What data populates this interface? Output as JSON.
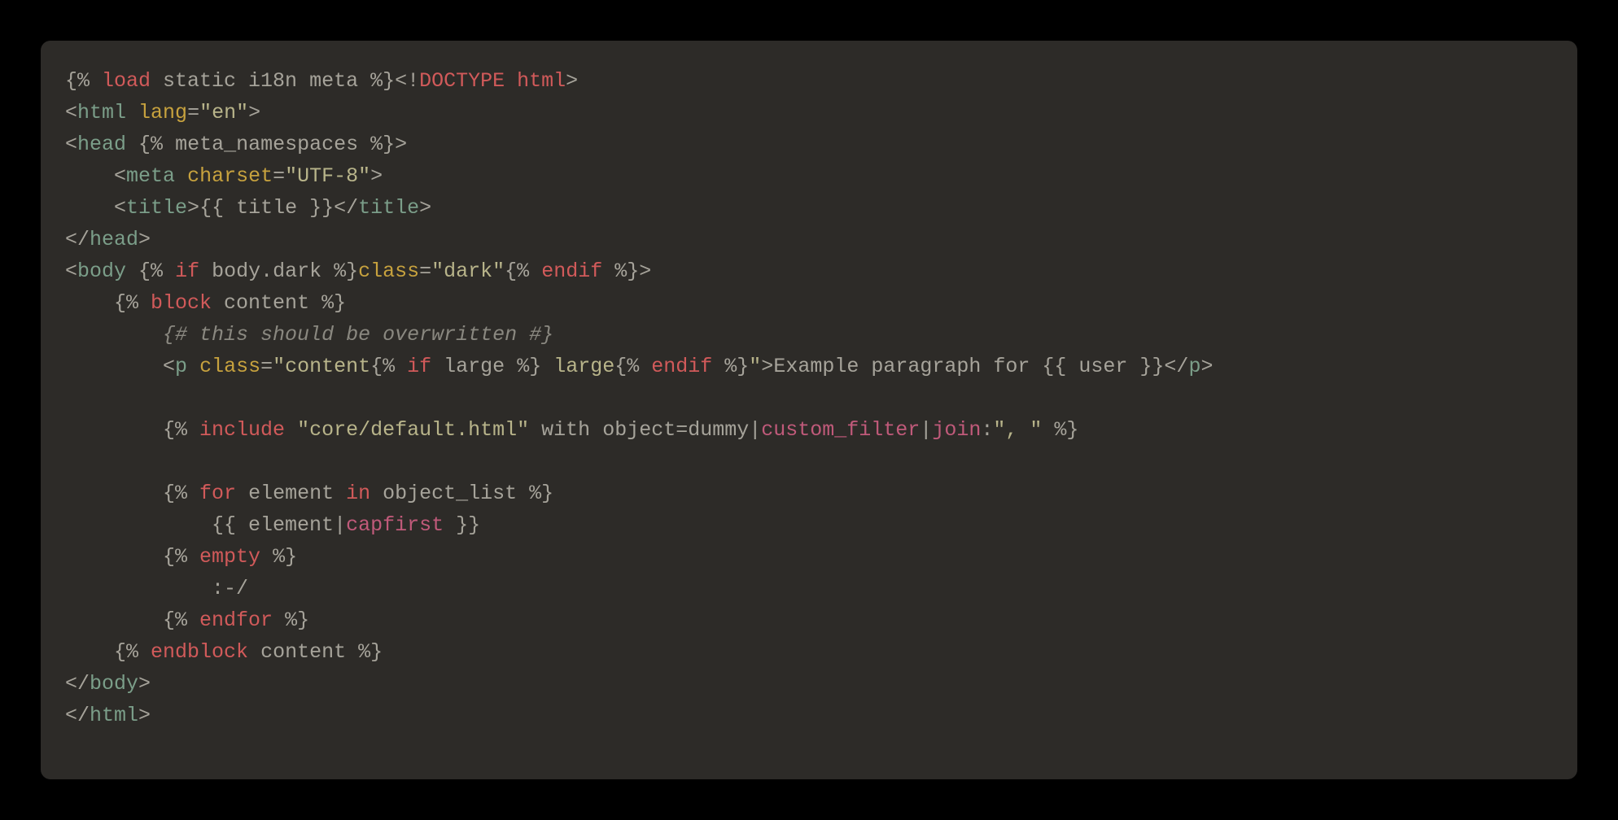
{
  "code": {
    "lines": [
      [
        {
          "t": "{% ",
          "c": "tok-delim"
        },
        {
          "t": "load",
          "c": "tok-keyword"
        },
        {
          "t": " static i18n meta ",
          "c": "tok-var"
        },
        {
          "t": "%}",
          "c": "tok-delim"
        },
        {
          "t": "<!",
          "c": "tok-delim"
        },
        {
          "t": "DOCTYPE html",
          "c": "tok-keyword"
        },
        {
          "t": ">",
          "c": "tok-delim"
        }
      ],
      [
        {
          "t": "<",
          "c": "tok-delim"
        },
        {
          "t": "html",
          "c": "tok-tag"
        },
        {
          "t": " ",
          "c": "tok-delim"
        },
        {
          "t": "lang",
          "c": "tok-attr"
        },
        {
          "t": "=",
          "c": "tok-delim"
        },
        {
          "t": "\"en\"",
          "c": "tok-string"
        },
        {
          "t": ">",
          "c": "tok-delim"
        }
      ],
      [
        {
          "t": "<",
          "c": "tok-delim"
        },
        {
          "t": "head",
          "c": "tok-tag"
        },
        {
          "t": " ",
          "c": "tok-delim"
        },
        {
          "t": "{% ",
          "c": "tok-delim"
        },
        {
          "t": "meta_namespaces",
          "c": "tok-var"
        },
        {
          "t": " %}",
          "c": "tok-delim"
        },
        {
          "t": ">",
          "c": "tok-delim"
        }
      ],
      [
        {
          "t": "    ",
          "c": "tok-delim"
        },
        {
          "t": "<",
          "c": "tok-delim"
        },
        {
          "t": "meta",
          "c": "tok-tag"
        },
        {
          "t": " ",
          "c": "tok-delim"
        },
        {
          "t": "charset",
          "c": "tok-attr"
        },
        {
          "t": "=",
          "c": "tok-delim"
        },
        {
          "t": "\"UTF-8\"",
          "c": "tok-string"
        },
        {
          "t": ">",
          "c": "tok-delim"
        }
      ],
      [
        {
          "t": "    ",
          "c": "tok-delim"
        },
        {
          "t": "<",
          "c": "tok-delim"
        },
        {
          "t": "title",
          "c": "tok-tag"
        },
        {
          "t": ">",
          "c": "tok-delim"
        },
        {
          "t": "{{ ",
          "c": "tok-delim"
        },
        {
          "t": "title",
          "c": "tok-var"
        },
        {
          "t": " }}",
          "c": "tok-delim"
        },
        {
          "t": "</",
          "c": "tok-delim"
        },
        {
          "t": "title",
          "c": "tok-tag"
        },
        {
          "t": ">",
          "c": "tok-delim"
        }
      ],
      [
        {
          "t": "</",
          "c": "tok-delim"
        },
        {
          "t": "head",
          "c": "tok-tag"
        },
        {
          "t": ">",
          "c": "tok-delim"
        }
      ],
      [
        {
          "t": "<",
          "c": "tok-delim"
        },
        {
          "t": "body",
          "c": "tok-tag"
        },
        {
          "t": " ",
          "c": "tok-delim"
        },
        {
          "t": "{% ",
          "c": "tok-delim"
        },
        {
          "t": "if",
          "c": "tok-keyword"
        },
        {
          "t": " body.dark ",
          "c": "tok-var"
        },
        {
          "t": "%}",
          "c": "tok-delim"
        },
        {
          "t": "class",
          "c": "tok-attr"
        },
        {
          "t": "=",
          "c": "tok-delim"
        },
        {
          "t": "\"dark\"",
          "c": "tok-string"
        },
        {
          "t": "{% ",
          "c": "tok-delim"
        },
        {
          "t": "endif",
          "c": "tok-keyword"
        },
        {
          "t": " %}",
          "c": "tok-delim"
        },
        {
          "t": ">",
          "c": "tok-delim"
        }
      ],
      [
        {
          "t": "    ",
          "c": "tok-delim"
        },
        {
          "t": "{% ",
          "c": "tok-delim"
        },
        {
          "t": "block",
          "c": "tok-keyword"
        },
        {
          "t": " content ",
          "c": "tok-var"
        },
        {
          "t": "%}",
          "c": "tok-delim"
        }
      ],
      [
        {
          "t": "        ",
          "c": "tok-delim"
        },
        {
          "t": "{# this should be overwritten #}",
          "c": "tok-comment"
        }
      ],
      [
        {
          "t": "        ",
          "c": "tok-delim"
        },
        {
          "t": "<",
          "c": "tok-delim"
        },
        {
          "t": "p",
          "c": "tok-tag"
        },
        {
          "t": " ",
          "c": "tok-delim"
        },
        {
          "t": "class",
          "c": "tok-attr"
        },
        {
          "t": "=",
          "c": "tok-delim"
        },
        {
          "t": "\"content",
          "c": "tok-string"
        },
        {
          "t": "{% ",
          "c": "tok-delim"
        },
        {
          "t": "if",
          "c": "tok-keyword"
        },
        {
          "t": " large ",
          "c": "tok-var"
        },
        {
          "t": "%}",
          "c": "tok-delim"
        },
        {
          "t": " large",
          "c": "tok-string"
        },
        {
          "t": "{% ",
          "c": "tok-delim"
        },
        {
          "t": "endif",
          "c": "tok-keyword"
        },
        {
          "t": " %}",
          "c": "tok-delim"
        },
        {
          "t": "\"",
          "c": "tok-string"
        },
        {
          "t": ">",
          "c": "tok-delim"
        },
        {
          "t": "Example paragraph for ",
          "c": "tok-text"
        },
        {
          "t": "{{ ",
          "c": "tok-delim"
        },
        {
          "t": "user",
          "c": "tok-var"
        },
        {
          "t": " }}",
          "c": "tok-delim"
        },
        {
          "t": "</",
          "c": "tok-delim"
        },
        {
          "t": "p",
          "c": "tok-tag"
        },
        {
          "t": ">",
          "c": "tok-delim"
        }
      ],
      [
        {
          "t": "",
          "c": "tok-delim"
        }
      ],
      [
        {
          "t": "        ",
          "c": "tok-delim"
        },
        {
          "t": "{% ",
          "c": "tok-delim"
        },
        {
          "t": "include",
          "c": "tok-keyword"
        },
        {
          "t": " ",
          "c": "tok-delim"
        },
        {
          "t": "\"core/default.html\"",
          "c": "tok-string"
        },
        {
          "t": " ",
          "c": "tok-delim"
        },
        {
          "t": "with",
          "c": "tok-var"
        },
        {
          "t": " ",
          "c": "tok-delim"
        },
        {
          "t": "object",
          "c": "tok-var"
        },
        {
          "t": "=",
          "c": "tok-delim"
        },
        {
          "t": "dummy",
          "c": "tok-var"
        },
        {
          "t": "|",
          "c": "tok-delim"
        },
        {
          "t": "custom_filter",
          "c": "tok-filter"
        },
        {
          "t": "|",
          "c": "tok-delim"
        },
        {
          "t": "join",
          "c": "tok-filter"
        },
        {
          "t": ":",
          "c": "tok-delim"
        },
        {
          "t": "\", \"",
          "c": "tok-string"
        },
        {
          "t": " %}",
          "c": "tok-delim"
        }
      ],
      [
        {
          "t": "",
          "c": "tok-delim"
        }
      ],
      [
        {
          "t": "        ",
          "c": "tok-delim"
        },
        {
          "t": "{% ",
          "c": "tok-delim"
        },
        {
          "t": "for",
          "c": "tok-keyword"
        },
        {
          "t": " element ",
          "c": "tok-var"
        },
        {
          "t": "in",
          "c": "tok-keyword"
        },
        {
          "t": " object_list ",
          "c": "tok-var"
        },
        {
          "t": "%}",
          "c": "tok-delim"
        }
      ],
      [
        {
          "t": "            ",
          "c": "tok-delim"
        },
        {
          "t": "{{ ",
          "c": "tok-delim"
        },
        {
          "t": "element",
          "c": "tok-var"
        },
        {
          "t": "|",
          "c": "tok-delim"
        },
        {
          "t": "capfirst",
          "c": "tok-filter"
        },
        {
          "t": " }}",
          "c": "tok-delim"
        }
      ],
      [
        {
          "t": "        ",
          "c": "tok-delim"
        },
        {
          "t": "{% ",
          "c": "tok-delim"
        },
        {
          "t": "empty",
          "c": "tok-keyword"
        },
        {
          "t": " %}",
          "c": "tok-delim"
        }
      ],
      [
        {
          "t": "            ",
          "c": "tok-delim"
        },
        {
          "t": ":-/",
          "c": "tok-text"
        }
      ],
      [
        {
          "t": "        ",
          "c": "tok-delim"
        },
        {
          "t": "{% ",
          "c": "tok-delim"
        },
        {
          "t": "endfor",
          "c": "tok-keyword"
        },
        {
          "t": " %}",
          "c": "tok-delim"
        }
      ],
      [
        {
          "t": "    ",
          "c": "tok-delim"
        },
        {
          "t": "{% ",
          "c": "tok-delim"
        },
        {
          "t": "endblock",
          "c": "tok-keyword"
        },
        {
          "t": " content ",
          "c": "tok-var"
        },
        {
          "t": "%}",
          "c": "tok-delim"
        }
      ],
      [
        {
          "t": "</",
          "c": "tok-delim"
        },
        {
          "t": "body",
          "c": "tok-tag"
        },
        {
          "t": ">",
          "c": "tok-delim"
        }
      ],
      [
        {
          "t": "</",
          "c": "tok-delim"
        },
        {
          "t": "html",
          "c": "tok-tag"
        },
        {
          "t": ">",
          "c": "tok-delim"
        }
      ]
    ]
  }
}
